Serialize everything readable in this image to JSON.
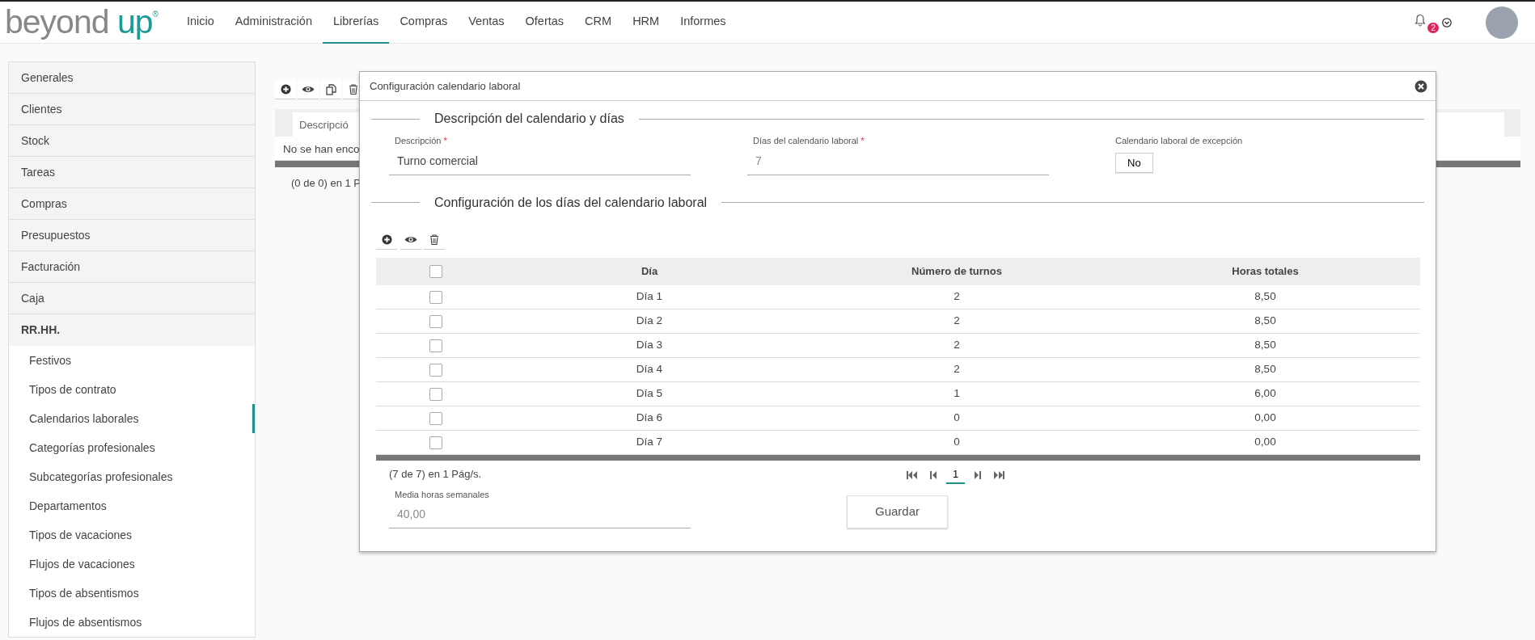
{
  "header": {
    "logo": {
      "word_1": "beyond",
      "word_2": "up",
      "mark": "®"
    },
    "nav": [
      {
        "label": "Inicio",
        "selected": false
      },
      {
        "label": "Administración",
        "selected": false
      },
      {
        "label": "Librerías",
        "selected": true
      },
      {
        "label": "Compras",
        "selected": false
      },
      {
        "label": "Ventas",
        "selected": false
      },
      {
        "label": "Ofertas",
        "selected": false
      },
      {
        "label": "CRM",
        "selected": false
      },
      {
        "label": "HRM",
        "selected": false
      },
      {
        "label": "Informes",
        "selected": false
      }
    ],
    "notifications": {
      "count": "2"
    }
  },
  "sidebar": {
    "items": [
      {
        "label": "Generales"
      },
      {
        "label": "Clientes"
      },
      {
        "label": "Stock"
      },
      {
        "label": "Tareas"
      },
      {
        "label": "Compras"
      },
      {
        "label": "Presupuestos"
      },
      {
        "label": "Facturación"
      },
      {
        "label": "Caja"
      },
      {
        "label": "RR.HH.",
        "expanded": true,
        "children": [
          {
            "label": "Festivos",
            "selected": false
          },
          {
            "label": "Tipos de contrato",
            "selected": false
          },
          {
            "label": "Calendarios laborales",
            "selected": true
          },
          {
            "label": "Categorías profesionales",
            "selected": false
          },
          {
            "label": "Subcategorías profesionales",
            "selected": false
          },
          {
            "label": "Departamentos",
            "selected": false
          },
          {
            "label": "Tipos de vacaciones",
            "selected": false
          },
          {
            "label": "Flujos de vacaciones",
            "selected": false
          },
          {
            "label": "Tipos de absentismos",
            "selected": false
          },
          {
            "label": "Flujos de absentismos",
            "selected": false
          }
        ]
      }
    ]
  },
  "background_list": {
    "filter_placeholder": "Descripció",
    "empty_message": "No se han enco",
    "paginator": "(0 de 0) en 1 P"
  },
  "dialog": {
    "title": "Configuración calendario laboral",
    "section_1": "Descripción del calendario y días",
    "fields": [
      {
        "label": "Descripción",
        "required_mark": "*",
        "value": "Turno comercial",
        "disabled": false
      },
      {
        "label": "Días del calendario laboral",
        "required_mark": "*",
        "value": "7",
        "disabled": true
      }
    ],
    "exception": {
      "label": "Calendario laboral de excepción",
      "value": "No"
    },
    "section_2": "Configuración de los días del calendario laboral",
    "table": {
      "select_all": false,
      "columns": [
        "Día",
        "Número de turnos",
        "Horas totales"
      ],
      "rows": [
        {
          "selected": false,
          "cells": [
            "Día 1",
            "2",
            "8,50"
          ]
        },
        {
          "selected": false,
          "cells": [
            "Día 2",
            "2",
            "8,50"
          ]
        },
        {
          "selected": false,
          "cells": [
            "Día 3",
            "2",
            "8,50"
          ]
        },
        {
          "selected": false,
          "cells": [
            "Día 4",
            "2",
            "8,50"
          ]
        },
        {
          "selected": false,
          "cells": [
            "Día 5",
            "1",
            "6,00"
          ]
        },
        {
          "selected": false,
          "cells": [
            "Día 6",
            "0",
            "0,00"
          ]
        },
        {
          "selected": false,
          "cells": [
            "Día 7",
            "0",
            "0,00"
          ]
        }
      ]
    },
    "paginator": {
      "summary": "(7 de 7) en 1 Pág/s.",
      "pages": [
        {
          "label": "1",
          "selected": true
        }
      ]
    },
    "average": {
      "label": "Media horas semanales",
      "value": "40,00",
      "disabled": true
    },
    "save_button": "Guardar"
  }
}
